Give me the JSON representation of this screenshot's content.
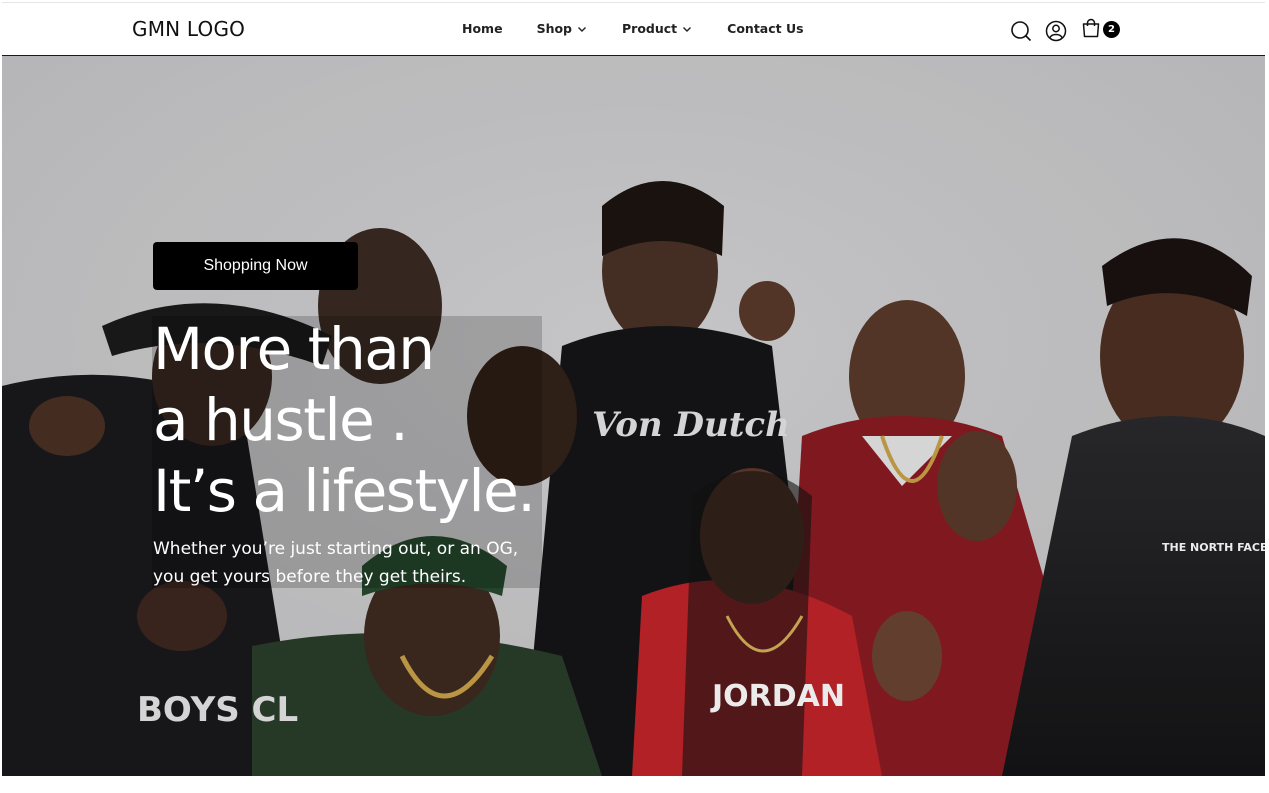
{
  "header": {
    "logo": "GMN LOGO",
    "nav": [
      {
        "label": "Home",
        "has_dropdown": false
      },
      {
        "label": "Shop",
        "has_dropdown": true
      },
      {
        "label": "Product",
        "has_dropdown": true
      },
      {
        "label": "Contact Us",
        "has_dropdown": false
      }
    ],
    "icons": [
      "search-icon",
      "account-icon",
      "cart-icon"
    ],
    "cart_count": "2"
  },
  "hero": {
    "cta_label": "Shopping Now",
    "headline": [
      "More than",
      "a hustle .",
      "It’s a lifestyle."
    ],
    "subtitle": [
      "Whether you’re just starting out, or an OG,",
      "you get yours before they get theirs."
    ]
  },
  "colors": {
    "accent": "#000000",
    "header_bg": "#ffffff",
    "hero_backdrop": "#cfcfcf"
  }
}
